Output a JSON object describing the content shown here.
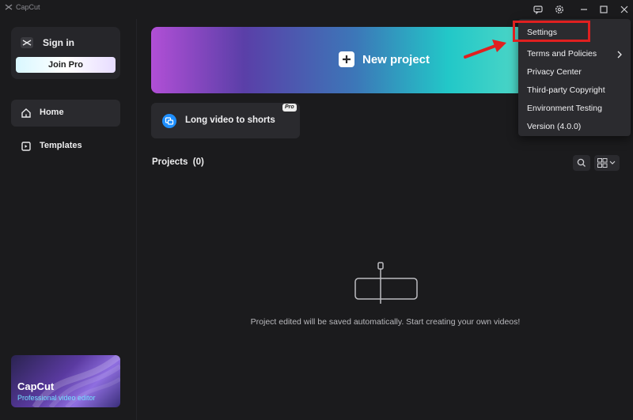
{
  "window": {
    "app_title": "CapCut"
  },
  "sidebar": {
    "sign_in": "Sign in",
    "join_pro": "Join Pro",
    "items": [
      {
        "label": "Home",
        "icon": "home-icon",
        "active": true
      },
      {
        "label": "Templates",
        "icon": "templates-icon",
        "active": false
      }
    ],
    "promo": {
      "title": "CapCut",
      "subtitle": "Professional video editor"
    }
  },
  "main": {
    "new_project": "New project",
    "long_video": "Long video to shorts",
    "pro_badge": "Pro",
    "projects_title": "Projects",
    "projects_count": "(0)",
    "empty_message": "Project edited will be saved automatically. Start creating your own videos!"
  },
  "menu": {
    "items": [
      {
        "label": "Settings"
      },
      {
        "label": "Terms and Policies",
        "has_submenu": true
      },
      {
        "label": "Privacy Center"
      },
      {
        "label": "Third-party Copyright"
      },
      {
        "label": "Environment Testing"
      },
      {
        "label": "Version (4.0.0)"
      }
    ]
  },
  "colors": {
    "background": "#1b1b1d",
    "card": "#2a2a2e",
    "annotation_red": "#e02020",
    "promo_accent": "#73e0ff"
  }
}
